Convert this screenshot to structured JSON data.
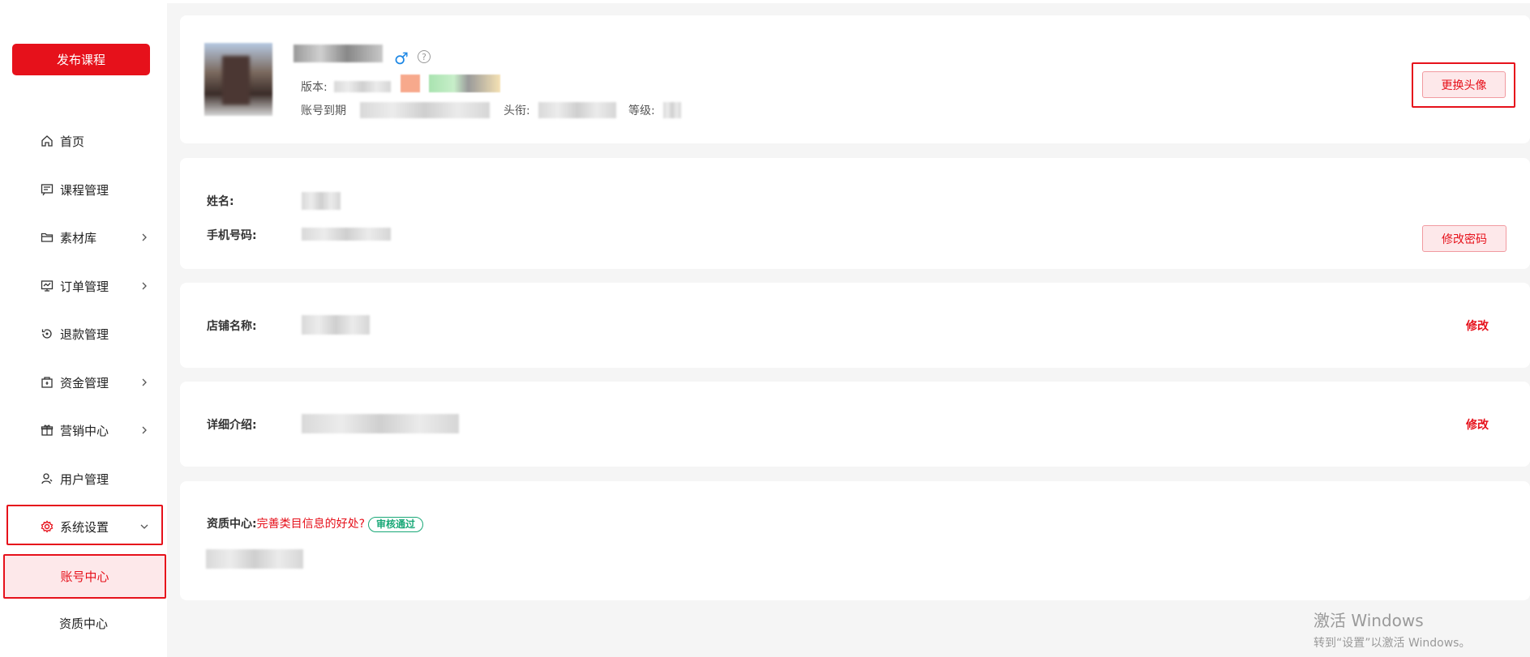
{
  "sidebar": {
    "publish_label": "发布课程",
    "items": [
      {
        "label": "首页",
        "icon": "home-icon",
        "chevron": false
      },
      {
        "label": "课程管理",
        "icon": "course-icon",
        "chevron": false
      },
      {
        "label": "素材库",
        "icon": "folder-icon",
        "chevron": true
      },
      {
        "label": "订单管理",
        "icon": "order-icon",
        "chevron": true
      },
      {
        "label": "退款管理",
        "icon": "refund-icon",
        "chevron": false
      },
      {
        "label": "资金管理",
        "icon": "wallet-icon",
        "chevron": true
      },
      {
        "label": "营销中心",
        "icon": "gift-icon",
        "chevron": true
      },
      {
        "label": "用户管理",
        "icon": "user-icon",
        "chevron": false
      },
      {
        "label": "系统设置",
        "icon": "gear-icon",
        "chevron": true,
        "expanded": true
      }
    ],
    "subitems": [
      {
        "label": "账号中心",
        "active": true
      },
      {
        "label": "资质中心",
        "active": false
      }
    ]
  },
  "profile": {
    "version_label": "版本:",
    "expire_label": "账号到期",
    "title_label": "头衔:",
    "level_label": "等级:",
    "change_avatar_label": "更换头像",
    "help_glyph": "?",
    "gender_glyph": "♂"
  },
  "info": {
    "name_label": "姓名:",
    "phone_label": "手机号码:",
    "change_password_label": "修改密码"
  },
  "shop": {
    "name_label": "店铺名称:",
    "edit_label": "修改"
  },
  "intro": {
    "label": "详细介绍:",
    "edit_label": "修改"
  },
  "qualification": {
    "label": "资质中心:",
    "link_text": "完善类目信息的好处?",
    "badge": "审核通过"
  },
  "watermark": {
    "line1": "激活 Windows",
    "line2": "转到“设置”以激活 Windows。"
  },
  "colors": {
    "accent": "#e6111b",
    "success": "#19a877",
    "gender": "#1e88e5"
  }
}
